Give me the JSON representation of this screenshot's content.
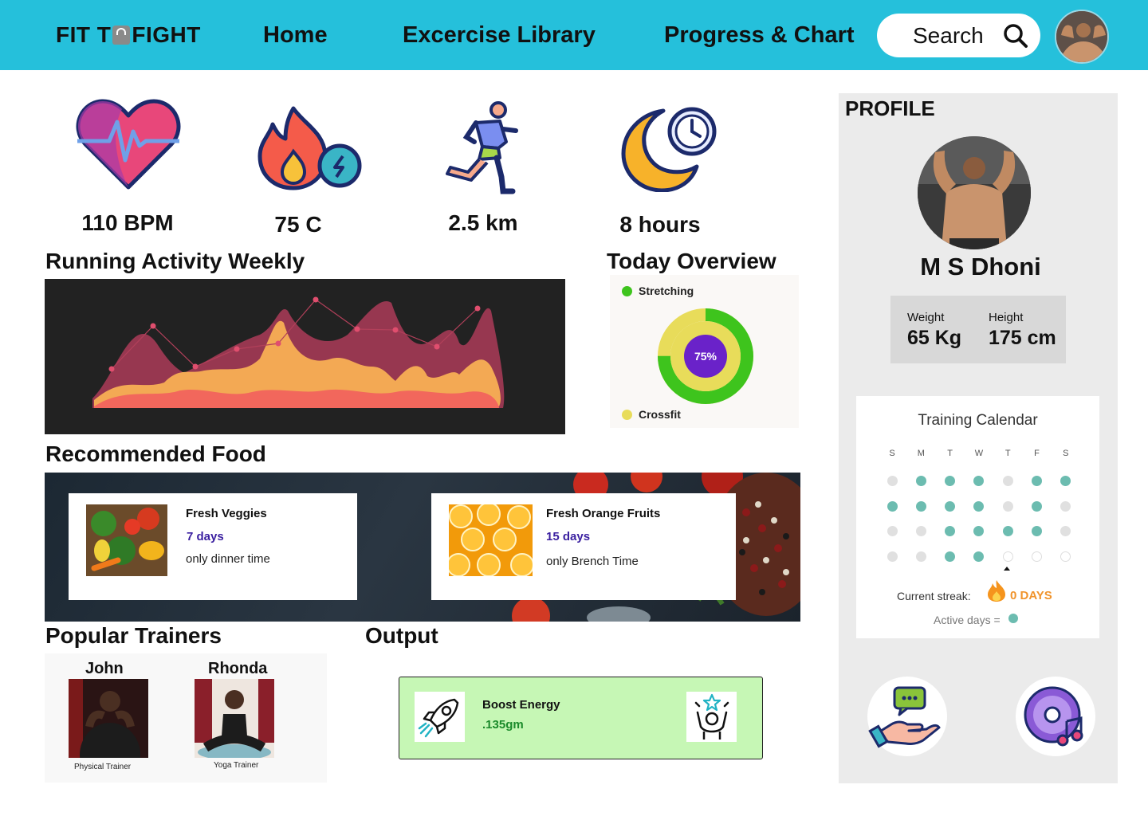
{
  "header": {
    "brand_part1": "FIT T",
    "brand_part2": "FIGHT",
    "nav": [
      "Home",
      "Excercise Library",
      "Progress & Chart"
    ],
    "search_label": "Search"
  },
  "stats": [
    {
      "value": "110 BPM",
      "icon": "heart-rate-icon"
    },
    {
      "value": "75 C",
      "icon": "calories-flame-icon"
    },
    {
      "value": "2.5 km",
      "icon": "running-icon"
    },
    {
      "value": "8 hours",
      "icon": "sleep-moon-clock-icon"
    }
  ],
  "running": {
    "title": "Running Activity Weekly"
  },
  "overview": {
    "title": "Today Overview",
    "legend": [
      {
        "label": "Stretching",
        "color": "#3ec41d"
      },
      {
        "label": "Crossfit",
        "color": "#e8dc5a"
      }
    ],
    "percent": "75%",
    "percent_value": 0.75,
    "center_color": "#6a22c9"
  },
  "food": {
    "title": "Recommended Food",
    "items": [
      {
        "name": "Fresh Veggies",
        "days": "7 days",
        "note": "only dinner time"
      },
      {
        "name": "Fresh Orange Fruits",
        "days": "15 days",
        "note": "only Brench Time"
      }
    ]
  },
  "trainers": {
    "title": "Popular Trainers",
    "items": [
      {
        "name": "John",
        "role": "Physical Trainer"
      },
      {
        "name": "Rhonda",
        "role": "Yoga Trainer"
      }
    ]
  },
  "output": {
    "title": "Output",
    "item_title": "Boost Energy",
    "item_value": ".135gm"
  },
  "profile": {
    "title": "PROFILE",
    "name": "M S Dhoni",
    "weight_label": "Weight",
    "weight_value": "65 Kg",
    "height_label": "Height",
    "height_value": "175 cm"
  },
  "calendar": {
    "title": "Training Calendar",
    "days": [
      "S",
      "M",
      "T",
      "W",
      "T",
      "F",
      "S"
    ],
    "rows": [
      [
        "inactive",
        "active",
        "active",
        "active",
        "inactive",
        "active",
        "active"
      ],
      [
        "active",
        "active",
        "active",
        "active",
        "inactive",
        "active",
        "inactive"
      ],
      [
        "inactive",
        "inactive",
        "active",
        "active",
        "active",
        "active",
        "inactive"
      ],
      [
        "inactive",
        "inactive",
        "active",
        "active",
        "future",
        "future",
        "future"
      ]
    ],
    "streak_label": "Current streak:",
    "streak_value": "0 DAYS",
    "active_label": "Active days =",
    "active_color": "#6cbcb0",
    "inactive_color": "#e0e0e0"
  },
  "colors": {
    "header": "#25c0db",
    "accent_purple": "#3a1fa0",
    "output_bg": "#c6f7b5"
  }
}
